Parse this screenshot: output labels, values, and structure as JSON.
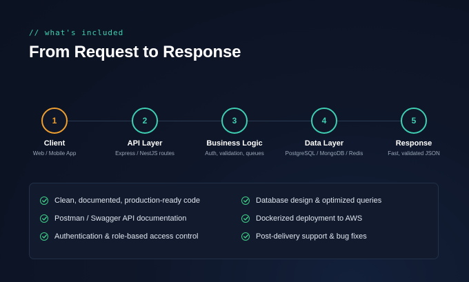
{
  "eyebrow": "// what's included",
  "title": "From Request to Response",
  "colors": {
    "accent": "#3fcfb2",
    "first_step": "#f0a030",
    "check": "#3fcf8a"
  },
  "steps": [
    {
      "number": "1",
      "title": "Client",
      "subtitle": "Web / Mobile App"
    },
    {
      "number": "2",
      "title": "API Layer",
      "subtitle": "Express / NestJS routes"
    },
    {
      "number": "3",
      "title": "Business Logic",
      "subtitle": "Auth, validation, queues"
    },
    {
      "number": "4",
      "title": "Data Layer",
      "subtitle": "PostgreSQL / MongoDB / Redis"
    },
    {
      "number": "5",
      "title": "Response",
      "subtitle": "Fast, validated JSON"
    }
  ],
  "features": {
    "left": [
      "Clean, documented, production-ready code",
      "Postman / Swagger API documentation",
      "Authentication & role-based access control"
    ],
    "right": [
      "Database design & optimized queries",
      "Dockerized deployment to AWS",
      "Post-delivery support & bug fixes"
    ],
    "icon": "check-circle-icon"
  }
}
